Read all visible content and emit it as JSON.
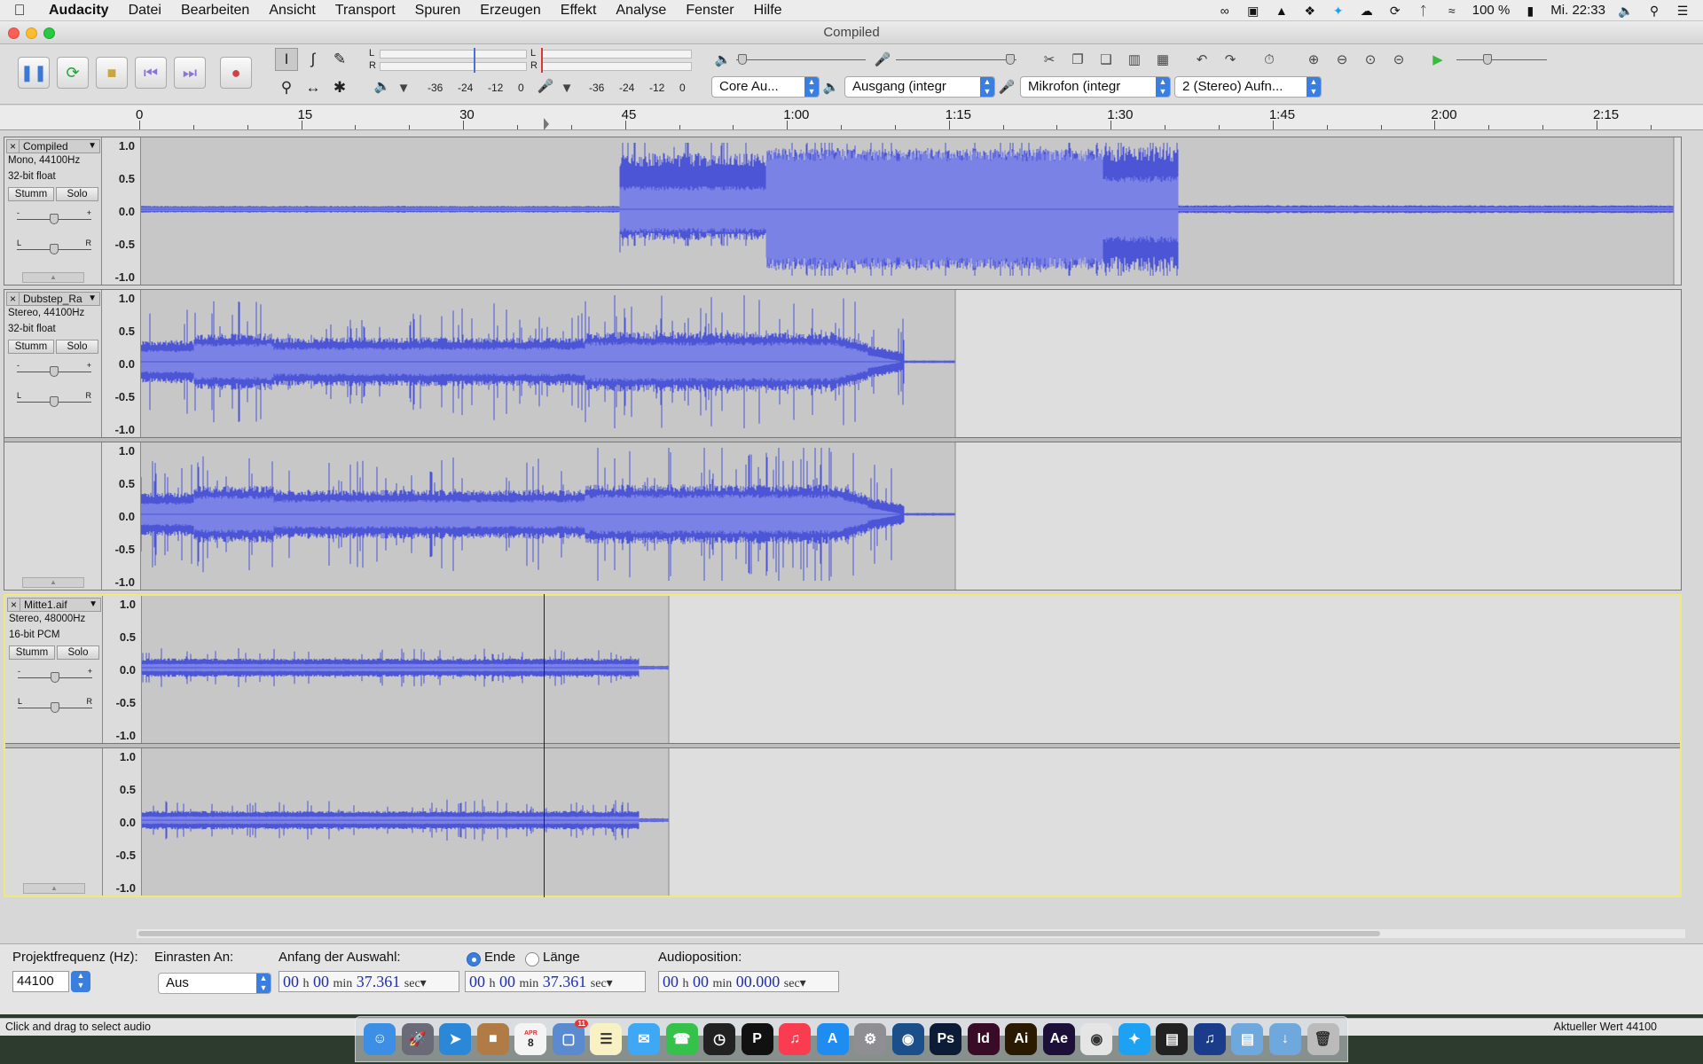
{
  "menubar": {
    "apple": "",
    "app_name": "Audacity",
    "items": [
      "Datei",
      "Bearbeiten",
      "Ansicht",
      "Transport",
      "Spuren",
      "Erzeugen",
      "Effekt",
      "Analyse",
      "Fenster",
      "Hilfe"
    ],
    "battery": "100 %",
    "clock": "Mi. 22:33",
    "status_icons": [
      "creative-cloud-icon",
      "airplay-icon",
      "drive-icon",
      "dropbox-icon",
      "twitter-icon",
      "cloud-icon",
      "sync-icon",
      "bluetooth-icon",
      "wifi-icon",
      "battery-icon",
      "volume-icon",
      "spotlight-icon",
      "notification-center-icon"
    ]
  },
  "window": {
    "title": "Compiled"
  },
  "meters": {
    "play_ticks": [
      "-36",
      "-24",
      "-12",
      "0"
    ],
    "rec_ticks": [
      "-36",
      "-24",
      "-12",
      "0"
    ],
    "left": "L",
    "right": "R"
  },
  "devices": {
    "host": "Core Au...",
    "output": "Ausgang (integr",
    "input": "Mikrofon (integr",
    "channels": "2 (Stereo) Aufn..."
  },
  "ruler": {
    "labels": [
      "0",
      "15",
      "30",
      "45",
      "1:00",
      "1:15",
      "1:30",
      "1:45",
      "2:00",
      "2:15"
    ]
  },
  "scale": [
    "1.0",
    "0.5",
    "0.0",
    "-0.5",
    "-1.0"
  ],
  "tracks": [
    {
      "name": "Compiled",
      "format": "Mono, 44100Hz",
      "depth": "32-bit float",
      "mute": "Stumm",
      "solo": "Solo"
    },
    {
      "name": "Dubstep_Ra",
      "format": "Stereo, 44100Hz",
      "depth": "32-bit float",
      "mute": "Stumm",
      "solo": "Solo"
    },
    {
      "name": "Mitte1.aif",
      "format": "Stereo, 48000Hz",
      "depth": "16-bit PCM",
      "mute": "Stumm",
      "solo": "Solo"
    }
  ],
  "gain_labels": {
    "minus": "-",
    "plus": "+",
    "l": "L",
    "r": "R"
  },
  "bottom": {
    "rate_label": "Projektfrequenz (Hz):",
    "rate_value": "44100",
    "snap_label": "Einrasten An:",
    "snap_value": "Aus",
    "sel_start_label": "Anfang der Auswahl:",
    "end_label": "Ende",
    "length_label": "Länge",
    "start_time": {
      "h": "00",
      "m": "00",
      "s": "37.361"
    },
    "end_time": {
      "h": "00",
      "m": "00",
      "s": "37.361"
    },
    "audio_pos_label": "Audioposition:",
    "pos_time": {
      "h": "00",
      "m": "00",
      "s": "00.000"
    },
    "unit_h": "h",
    "unit_min": "min",
    "unit_sec": "sec"
  },
  "status": {
    "left": "Click and drag to select audio",
    "right": "Aktueller Wert 44100"
  },
  "dock": [
    "Finder",
    "Launchpad",
    "Safari",
    "Kontakte",
    "Kalender",
    "Vorschau",
    "Notizen",
    "Nachrichten",
    "FaceTime",
    "Uhr",
    "P",
    "iTunes",
    "App Store",
    "Systemeinstellungen",
    "Cinema",
    "Ps",
    "Id",
    "Ai",
    "Ae",
    "Chrome",
    "Twitter",
    "Aktivität",
    "Audacity",
    "Ordner",
    "Downloads",
    "Papierkorb"
  ],
  "dock_badges": {
    "calendar_day": "8",
    "calendar_month": "APR",
    "preview_badge": "11"
  },
  "colors": {
    "wave": "#4b55d6",
    "wave_rms": "#7b82e6",
    "clip_bg": "#c7c7c7",
    "empty_bg": "#dedede",
    "selected_border": "#f2e87a"
  }
}
